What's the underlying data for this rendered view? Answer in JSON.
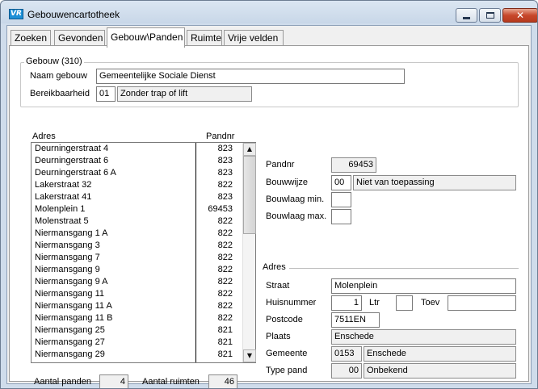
{
  "window": {
    "icon_text": "VR",
    "title": "Gebouwencartotheek",
    "minimize_label": "",
    "maximize_label": "",
    "close_label": "✕"
  },
  "tabs": [
    {
      "label": "Zoeken"
    },
    {
      "label": "Gevonden"
    },
    {
      "label": "Gebouw\\Panden"
    },
    {
      "label": "Ruimte"
    },
    {
      "label": "Vrije velden"
    }
  ],
  "gebouw": {
    "group_title": "Gebouw (310)",
    "naam_label": "Naam gebouw",
    "naam_value": "Gemeentelijke Sociale Dienst",
    "bereik_label": "Bereikbaarheid",
    "bereik_code": "01",
    "bereik_desc": "Zonder trap of lift"
  },
  "list": {
    "header_adres": "Adres",
    "header_pandnr": "Pandnr",
    "rows": [
      {
        "adres": "Deurningerstraat 4",
        "pandnr": "823"
      },
      {
        "adres": "Deurningerstraat 6",
        "pandnr": "823"
      },
      {
        "adres": "Deurningerstraat 6 A",
        "pandnr": "823"
      },
      {
        "adres": "Lakerstraat 32",
        "pandnr": "822"
      },
      {
        "adres": "Lakerstraat 41",
        "pandnr": "823"
      },
      {
        "adres": "Molenplein 1",
        "pandnr": "69453"
      },
      {
        "adres": "Molenstraat 5",
        "pandnr": "822"
      },
      {
        "adres": "Niermansgang 1 A",
        "pandnr": "822"
      },
      {
        "adres": "Niermansgang 3",
        "pandnr": "822"
      },
      {
        "adres": "Niermansgang 7",
        "pandnr": "822"
      },
      {
        "adres": "Niermansgang 9",
        "pandnr": "822"
      },
      {
        "adres": "Niermansgang 9 A",
        "pandnr": "822"
      },
      {
        "adres": "Niermansgang 11",
        "pandnr": "822"
      },
      {
        "adres": "Niermansgang 11 A",
        "pandnr": "822"
      },
      {
        "adres": "Niermansgang 11 B",
        "pandnr": "822"
      },
      {
        "adres": "Niermansgang 25",
        "pandnr": "821"
      },
      {
        "adres": "Niermansgang 27",
        "pandnr": "821"
      },
      {
        "adres": "Niermansgang 29",
        "pandnr": "821"
      }
    ],
    "scroll_up": "▲",
    "scroll_down": "▼"
  },
  "totals": {
    "panden_label": "Aantal panden",
    "panden_value": "4",
    "ruimten_label": "Aantal ruimten",
    "ruimten_value": "46"
  },
  "pand": {
    "pandnr_label": "Pandnr",
    "pandnr_value": "69453",
    "bouwwijze_label": "Bouwwijze",
    "bouwwijze_code": "00",
    "bouwwijze_desc": "Niet van toepassing",
    "laag_min_label": "Bouwlaag min.",
    "laag_min_value": "",
    "laag_max_label": "Bouwlaag max.",
    "laag_max_value": ""
  },
  "adres": {
    "section_title": "Adres",
    "straat_label": "Straat",
    "straat_value": "Molenplein",
    "huisnr_label": "Huisnummer",
    "huisnr_value": "1",
    "ltr_label": "Ltr",
    "ltr_value": "",
    "toev_label": "Toev",
    "toev_value": "",
    "postcode_label": "Postcode",
    "postcode_value": "7511EN",
    "plaats_label": "Plaats",
    "plaats_value": "Enschede",
    "gemeente_label": "Gemeente",
    "gemeente_code": "0153",
    "gemeente_name": "Enschede",
    "typepand_label": "Type pand",
    "typepand_code": "00",
    "typepand_desc": "Onbekend"
  }
}
